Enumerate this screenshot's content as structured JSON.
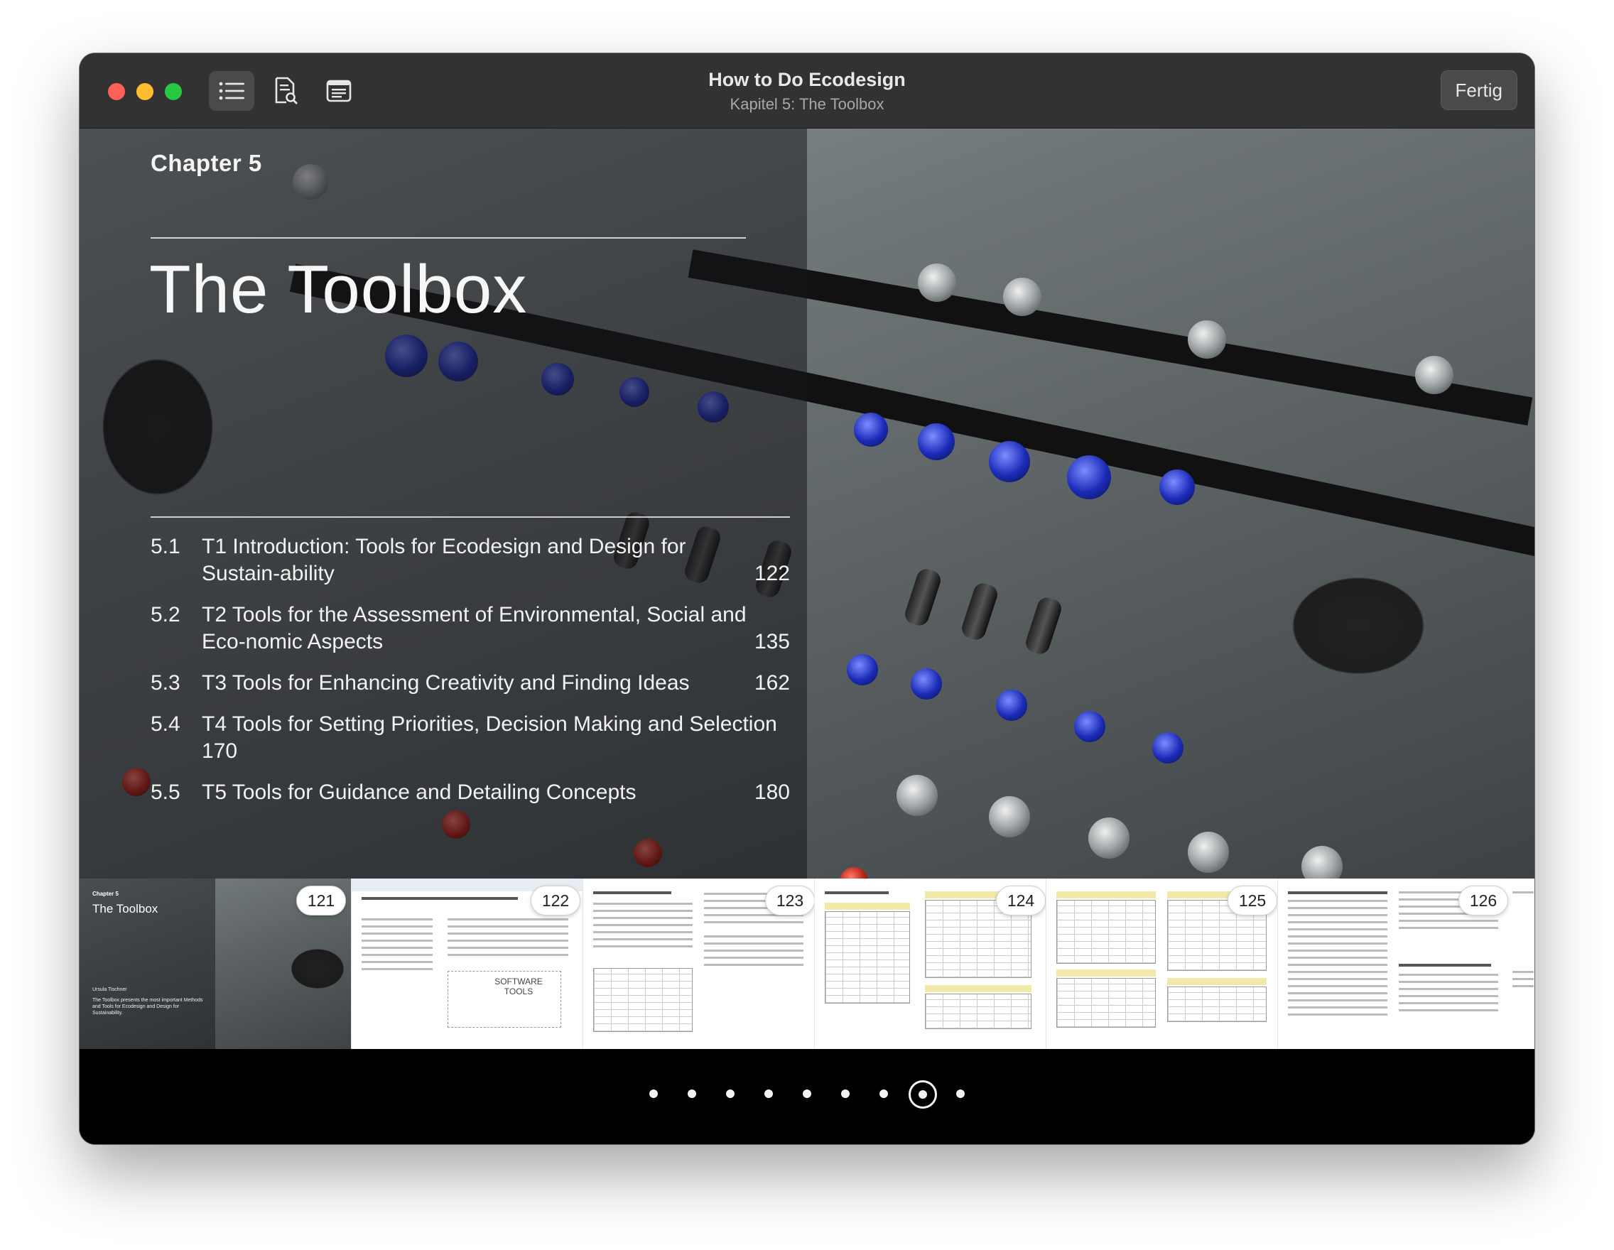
{
  "window": {
    "title": "How to Do Ecodesign",
    "subtitle": "Kapitel 5: The Toolbox",
    "done_label": "Fertig"
  },
  "toolbar": {
    "icons": [
      "list-icon",
      "page-search-icon",
      "notes-icon"
    ],
    "active": "list-icon"
  },
  "page": {
    "chapter_label": "Chapter 5",
    "title": "The Toolbox",
    "toc": [
      {
        "num": "5.1",
        "text": "T1 Introduction: Tools for Ecodesign and Design for Sustain-ability",
        "page": "122"
      },
      {
        "num": "5.2",
        "text": "T2 Tools for the Assessment of Environmental, Social and Eco-nomic Aspects",
        "page": "135"
      },
      {
        "num": "5.3",
        "text": "T3 Tools for Enhancing Creativity and Finding Ideas",
        "page": "162"
      },
      {
        "num": "5.4",
        "text": "T4 Tools for Setting Priorities, Decision Making and Selection",
        "page": "170"
      },
      {
        "num": "5.5",
        "text": "T5 Tools for Guidance and Detailing Concepts",
        "page": "180"
      }
    ]
  },
  "thumbnails": {
    "cover": {
      "chapter": "Chapter 5",
      "title": "The Toolbox",
      "author": "Ursula Tischner",
      "blurb": "The Toolbox presents the most important Methods and Tools for Ecodesign and Design for Sustainability."
    },
    "page_numbers": [
      "121",
      "122",
      "123",
      "124",
      "125",
      "126"
    ],
    "software_tools_label": "SOFTWARE TOOLS"
  },
  "pagination": {
    "count": 9,
    "current_index": 7
  },
  "colors": {
    "titlebar": "#323232",
    "traffic_red": "#fe5f57",
    "traffic_yellow": "#febc2e",
    "traffic_green": "#28c840"
  }
}
